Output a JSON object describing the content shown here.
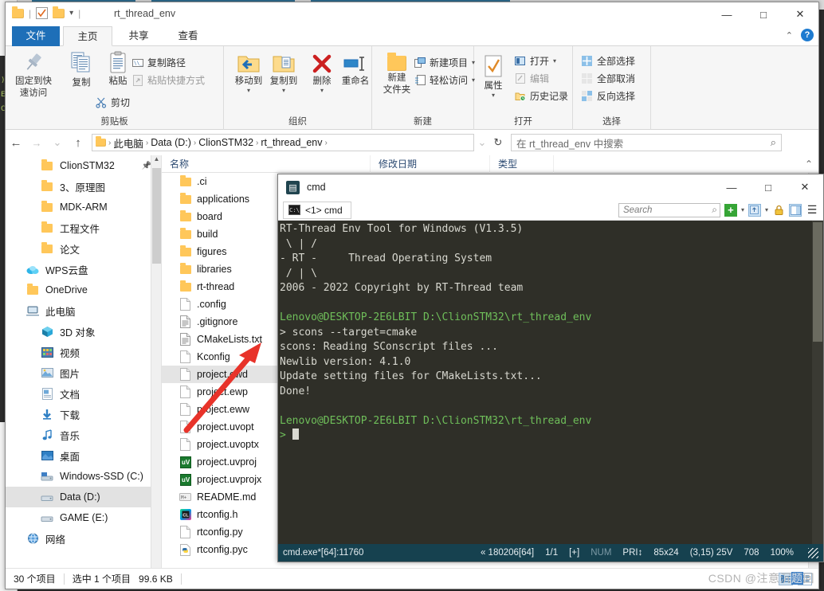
{
  "window": {
    "title": "rt_thread_env",
    "minimize": "—",
    "maximize": "□",
    "close": "✕",
    "ribbon_collapse": "⌃",
    "help": "?"
  },
  "tabs": [
    {
      "label": "文件",
      "name": "tab-file"
    },
    {
      "label": "主页",
      "name": "tab-home"
    },
    {
      "label": "共享",
      "name": "tab-share"
    },
    {
      "label": "查看",
      "name": "tab-view"
    }
  ],
  "ribbon": {
    "groups": [
      {
        "label": "剪贴板"
      },
      {
        "label": "组织"
      },
      {
        "label": "新建"
      },
      {
        "label": "打开"
      },
      {
        "label": "选择"
      }
    ],
    "pin_to_quick_access": "固定到快\n速访问",
    "pin_line1": "固定到快",
    "pin_line2": "速访问",
    "copy": "复制",
    "paste": "粘贴",
    "copy_path": "复制路径",
    "paste_shortcut": "粘贴快捷方式",
    "cut": "剪切",
    "move_to": "移动到",
    "copy_to": "复制到",
    "delete": "删除",
    "rename": "重命名",
    "new_folder_line1": "新建",
    "new_folder_line2": "文件夹",
    "new_item": "新建项目",
    "easy_access": "轻松访问",
    "properties": "属性",
    "open": "打开",
    "edit": "编辑",
    "history": "历史记录",
    "select_all": "全部选择",
    "select_none": "全部取消",
    "invert_selection": "反向选择"
  },
  "address": {
    "back": "←",
    "forward": "→",
    "recent": "⌄",
    "up": "↑",
    "refresh": "↻",
    "dropdown": "⌄",
    "crumbs": [
      "此电脑",
      "Data (D:)",
      "ClionSTM32",
      "rt_thread_env"
    ],
    "crumb_sep": "›",
    "search_placeholder": "在 rt_thread_env 中搜索",
    "search_icon": "⌕"
  },
  "nav": {
    "items": [
      {
        "label": "ClionSTM32",
        "icon": "folder",
        "indent": 2,
        "pinned": true
      },
      {
        "label": "3、原理图",
        "icon": "folder",
        "indent": 2
      },
      {
        "label": "MDK-ARM",
        "icon": "folder",
        "indent": 2
      },
      {
        "label": "工程文件",
        "icon": "folder",
        "indent": 2
      },
      {
        "label": "论文",
        "icon": "folder",
        "indent": 2
      },
      {
        "label": "WPS云盘",
        "icon": "cloud",
        "indent": 1
      },
      {
        "label": "OneDrive",
        "icon": "folder",
        "indent": 1
      },
      {
        "label": "此电脑",
        "icon": "pc",
        "indent": 1
      },
      {
        "label": "3D 对象",
        "icon": "cube",
        "indent": 2
      },
      {
        "label": "视频",
        "icon": "video",
        "indent": 2
      },
      {
        "label": "图片",
        "icon": "picture",
        "indent": 2
      },
      {
        "label": "文档",
        "icon": "document",
        "indent": 2
      },
      {
        "label": "下载",
        "icon": "download",
        "indent": 2
      },
      {
        "label": "音乐",
        "icon": "music",
        "indent": 2
      },
      {
        "label": "桌面",
        "icon": "desktop",
        "indent": 2
      },
      {
        "label": "Windows-SSD (C:)",
        "icon": "sysdrive",
        "indent": 2
      },
      {
        "label": "Data (D:)",
        "icon": "drive",
        "indent": 2,
        "selected": true
      },
      {
        "label": "GAME (E:)",
        "icon": "drive",
        "indent": 2
      },
      {
        "label": "网络",
        "icon": "network",
        "indent": 1
      }
    ]
  },
  "filelist": {
    "columns": [
      "名称",
      "修改日期",
      "类型"
    ],
    "sort_indicator": "⌃",
    "items": [
      {
        "name": ".ci",
        "icon": "folder"
      },
      {
        "name": "applications",
        "icon": "folder"
      },
      {
        "name": "board",
        "icon": "folder"
      },
      {
        "name": "build",
        "icon": "folder"
      },
      {
        "name": "figures",
        "icon": "folder"
      },
      {
        "name": "libraries",
        "icon": "folder"
      },
      {
        "name": "rt-thread",
        "icon": "folder"
      },
      {
        "name": ".config",
        "icon": "blankdoc"
      },
      {
        "name": ".gitignore",
        "icon": "textdoc"
      },
      {
        "name": "CMakeLists.txt",
        "icon": "textdoc"
      },
      {
        "name": "Kconfig",
        "icon": "blankdoc"
      },
      {
        "name": "project.ewd",
        "icon": "blankdoc",
        "selected": true
      },
      {
        "name": "project.ewp",
        "icon": "blankdoc"
      },
      {
        "name": "project.eww",
        "icon": "blankdoc"
      },
      {
        "name": "project.uvopt",
        "icon": "blankdoc"
      },
      {
        "name": "project.uvoptx",
        "icon": "blankdoc"
      },
      {
        "name": "project.uvproj",
        "icon": "keil"
      },
      {
        "name": "project.uvprojx",
        "icon": "keil"
      },
      {
        "name": "README.md",
        "icon": "md"
      },
      {
        "name": "rtconfig.h",
        "icon": "clion"
      },
      {
        "name": "rtconfig.py",
        "icon": "blankdoc"
      },
      {
        "name": "rtconfig.pyc",
        "icon": "python"
      }
    ]
  },
  "explorer_status": {
    "total": "30 个项目",
    "selected": "选中 1 个项目",
    "size": "99.6 KB"
  },
  "cmd": {
    "title": "cmd",
    "icon_glyph": "▤",
    "tab_label": "<1> cmd",
    "tab_icon": "C:\\",
    "minimize": "—",
    "maximize": "□",
    "close": "✕",
    "search_placeholder": "Search",
    "search_icon": "⌕",
    "new_tab": "+",
    "dropdown": "▾",
    "lock": "🔒",
    "menu": "☰",
    "terminal_lines": [
      {
        "text": "RT-Thread Env Tool for Windows (V1.3.5)",
        "color": "white"
      },
      {
        "text": " \\ | /",
        "color": "white"
      },
      {
        "text": "- RT -     Thread Operating System",
        "color": "white"
      },
      {
        "text": " / | \\",
        "color": "white"
      },
      {
        "text": "2006 - 2022 Copyright by RT-Thread team",
        "color": "white"
      },
      {
        "text": "",
        "color": "white"
      },
      {
        "text": "Lenovo@DESKTOP-2E6LBIT D:\\ClionSTM32\\rt_thread_env",
        "color": "green"
      },
      {
        "text": "> scons --target=cmake",
        "color": "white"
      },
      {
        "text": "scons: Reading SConscript files ...",
        "color": "white"
      },
      {
        "text": "Newlib version: 4.1.0",
        "color": "white"
      },
      {
        "text": "Update setting files for CMakeLists.txt...",
        "color": "white"
      },
      {
        "text": "Done!",
        "color": "white"
      },
      {
        "text": "",
        "color": "white"
      },
      {
        "text": "Lenovo@DESKTOP-2E6LBIT D:\\ClionSTM32\\rt_thread_env",
        "color": "green"
      }
    ],
    "prompt": ">",
    "status": {
      "process": "cmd.exe*[64]:11760",
      "mem": "« 180206[64]",
      "tabs": "1/1",
      "mode": "[+]",
      "num": "NUM",
      "pri": "PRI↕",
      "size": "85x24",
      "cursor": "(3,15) 25V",
      "lines": "708",
      "zoom": "100%"
    }
  },
  "watermark": {
    "text_before": "CSDN @注意沉",
    "text_highlight": "题",
    "text_after": "回"
  },
  "colors": {
    "accent": "#1e6fb8",
    "terminal_bg": "#2f2f28",
    "terminal_green": "#6fbf5a",
    "status_bg": "#16414f",
    "folder": "#ffc75a",
    "selection": "#e4e4e4"
  }
}
